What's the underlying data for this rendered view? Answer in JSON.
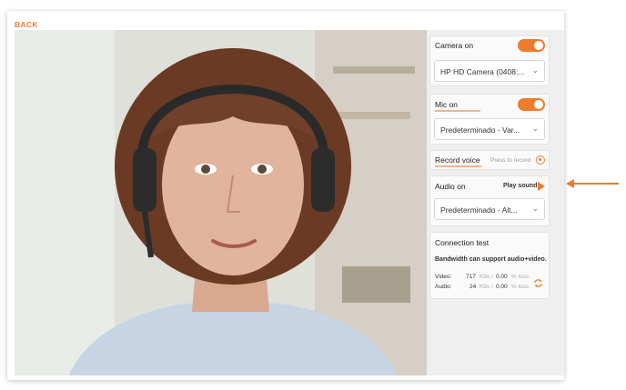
{
  "nav": {
    "back_label": "BACK"
  },
  "camera": {
    "title": "Camera on",
    "enabled": true,
    "device": "HP HD Camera (0408:..."
  },
  "mic": {
    "title": "Mic on",
    "enabled": true,
    "device": "Predeterminado - Var..."
  },
  "record": {
    "title": "Record voice",
    "action": "Press to record"
  },
  "audio": {
    "title": "Audio on",
    "action": "Play sound",
    "device": "Predeterminado - Alt..."
  },
  "connection": {
    "title": "Connection test",
    "status": "Bandwidth can support audio+video.",
    "video": {
      "label": "Video:",
      "value": "717",
      "unit": "Kbs /",
      "loss": "0.00",
      "loss_unit": "% loss"
    },
    "audio": {
      "label": "Audio:",
      "value": "24",
      "unit": "Kbs /",
      "loss": "0.00",
      "loss_unit": "% loss"
    }
  },
  "colors": {
    "accent": "#f07b2c",
    "panel": "#efefef"
  },
  "icons": [
    "chevron-down-icon",
    "record-icon",
    "play-icon",
    "refresh-icon",
    "arrow-left-icon"
  ]
}
